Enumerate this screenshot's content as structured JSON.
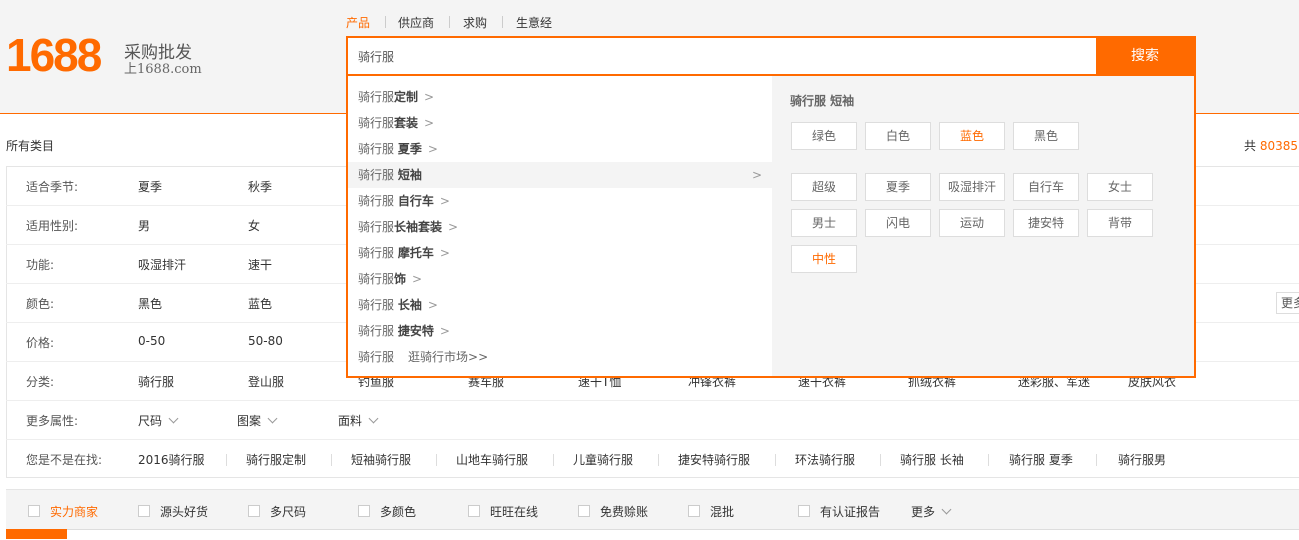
{
  "logo": {
    "number": "1688",
    "slogan": "采购批发",
    "sub": "上1688.com"
  },
  "search": {
    "tabs": [
      {
        "label": "产品",
        "active": true
      },
      {
        "label": "供应商",
        "active": false
      },
      {
        "label": "求购",
        "active": false
      },
      {
        "label": "生意经",
        "active": false
      }
    ],
    "query": "骑行服",
    "button_label": "搜索"
  },
  "page": {
    "all_categories": "所有类目",
    "total_prefix": "共",
    "total_count": "80385"
  },
  "filters": [
    {
      "label": "适合季节:",
      "options": [
        "夏季",
        "秋季"
      ]
    },
    {
      "label": "适用性别:",
      "options": [
        "男",
        "女"
      ]
    },
    {
      "label": "功能:",
      "options": [
        "吸湿排汗",
        "速干"
      ]
    },
    {
      "label": "颜色:",
      "options": [
        "黑色",
        "蓝色"
      ]
    },
    {
      "label": "价格:",
      "options": [
        "0-50",
        "50-80"
      ]
    },
    {
      "label": "分类:",
      "options": [
        "骑行服",
        "登山服",
        "钓鱼服",
        "赛车服",
        "速干T恤",
        "冲锋衣裤",
        "速干衣裤",
        "抓绒衣裤",
        "迷彩服、军迷",
        "皮肤风衣"
      ]
    },
    {
      "label": "更多属性:",
      "options": [
        "尺码",
        "图案",
        "面料"
      ]
    },
    {
      "label": "您是不是在找:",
      "options": [
        "2016骑行服",
        "骑行服定制",
        "短袖骑行服",
        "山地车骑行服",
        "儿童骑行服",
        "捷安特骑行服",
        "环法骑行服",
        "骑行服 长袖",
        "骑行服 夏季",
        "骑行服男"
      ]
    }
  ],
  "more_label": "更多",
  "bottom_bar": {
    "checks": [
      "实力商家",
      "源头好货",
      "多尺码",
      "多颜色",
      "旺旺在线",
      "免费赊账",
      "混批",
      "有认证报告"
    ],
    "more_label": "更多"
  },
  "dropdown": {
    "suggestions": [
      {
        "base": "骑行服",
        "bold": "定制",
        "arrow": ">"
      },
      {
        "base": "骑行服",
        "bold": "套装",
        "arrow": ">"
      },
      {
        "base": "骑行服 ",
        "bold": "夏季",
        "arrow": ">"
      },
      {
        "base": "骑行服 ",
        "bold": "短袖",
        "arrow": ">"
      },
      {
        "base": "骑行服 ",
        "bold": "自行车",
        "arrow": ">"
      },
      {
        "base": "骑行服",
        "bold": "长袖套装",
        "arrow": ">"
      },
      {
        "base": "骑行服 ",
        "bold": "摩托车",
        "arrow": ">"
      },
      {
        "base": "骑行服",
        "bold": "饰",
        "arrow": ">"
      },
      {
        "base": "骑行服 ",
        "bold": "长袖",
        "arrow": ">"
      },
      {
        "base": "骑行服 ",
        "bold": "捷安特",
        "arrow": ">"
      }
    ],
    "market_prefix": "骑行服",
    "market_link": "逛骑行市场>>",
    "panel_title": "骑行服 短袖",
    "color_tags": [
      "绿色",
      "白色",
      "蓝色",
      "黑色"
    ],
    "attr_tags": [
      "超级",
      "夏季",
      "吸湿排汗",
      "自行车",
      "女士",
      "男士",
      "闪电",
      "运动",
      "捷安特",
      "背带",
      "中性"
    ]
  },
  "colors": {
    "accent": "#ff6a00"
  }
}
